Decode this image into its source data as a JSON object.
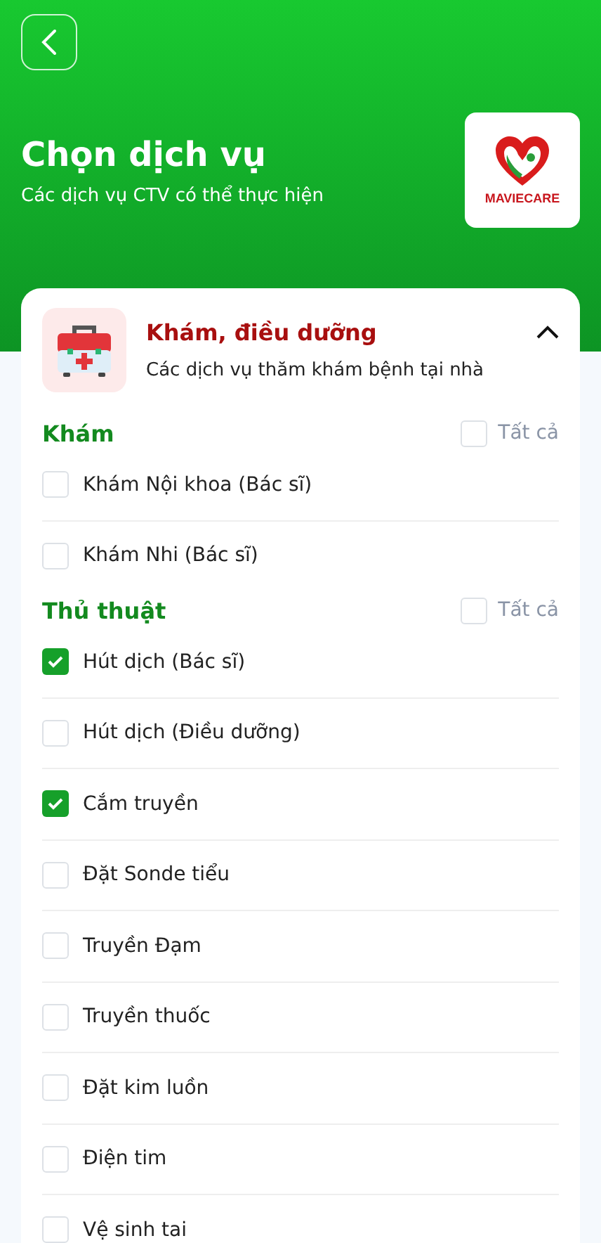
{
  "header": {
    "title": "Chọn dịch vụ",
    "subtitle": "Các dịch vụ CTV có thể thực hiện",
    "logo_text": "MAVIECARE"
  },
  "category": {
    "title": "Khám, điều dưỡng",
    "description": "Các dịch vụ thăm khám bệnh tại nhà",
    "expanded": true,
    "groups": [
      {
        "title": "Khám",
        "select_all": {
          "label": "Tất cả",
          "checked": false
        },
        "items": [
          {
            "label": "Khám Nội khoa (Bác sĩ)",
            "checked": false
          },
          {
            "label": "Khám Nhi (Bác sĩ)",
            "checked": false
          }
        ]
      },
      {
        "title": "Thủ thuật",
        "select_all": {
          "label": "Tất cả",
          "checked": false
        },
        "items": [
          {
            "label": "Hút dịch (Bác sĩ)",
            "checked": true
          },
          {
            "label": "Hút dịch (Điều dưỡng)",
            "checked": false
          },
          {
            "label": "Cắm truyền",
            "checked": true
          },
          {
            "label": "Đặt Sonde tiểu",
            "checked": false
          },
          {
            "label": "Truyền Đạm",
            "checked": false
          },
          {
            "label": "Truyền thuốc",
            "checked": false
          },
          {
            "label": "Đặt kim luồn",
            "checked": false
          },
          {
            "label": "Điện tim",
            "checked": false
          },
          {
            "label": "Vệ sinh tai",
            "checked": false
          }
        ]
      }
    ]
  }
}
